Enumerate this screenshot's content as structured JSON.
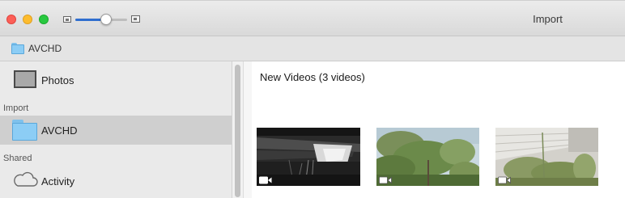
{
  "window": {
    "title": "Import"
  },
  "toolbar": {
    "thumbnail_slider": {
      "value": 0.6
    },
    "path": {
      "folder_label": "AVCHD",
      "icon": "folder-icon"
    }
  },
  "sidebar": {
    "library_items": [
      {
        "label": "Photos",
        "icon": "photos-icon"
      }
    ],
    "sections": [
      {
        "header": "Import",
        "items": [
          {
            "label": "AVCHD",
            "icon": "folder-icon",
            "selected": true
          }
        ]
      },
      {
        "header": "Shared",
        "items": [
          {
            "label": "Activity",
            "icon": "cloud-icon"
          }
        ]
      }
    ]
  },
  "main": {
    "section_title": "New Videos (3 videos)",
    "videos": [
      {
        "icon": "video-camera-icon",
        "scene": "dark bridge underside"
      },
      {
        "icon": "video-camera-icon",
        "scene": "green tree against sky"
      },
      {
        "icon": "video-camera-icon",
        "scene": "weeds by a building wall"
      }
    ]
  },
  "colors": {
    "accent": "#2f6ecf",
    "close": "#fc5f57",
    "minimize": "#fdbc2e",
    "zoom": "#28c840",
    "folder": "#8ccdf5",
    "selection": "#cfcfcf"
  }
}
